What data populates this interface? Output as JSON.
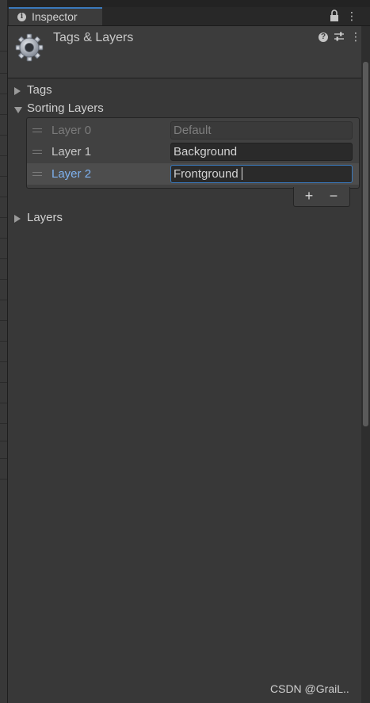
{
  "window": {
    "tab_label": "Inspector"
  },
  "header": {
    "title": "Tags & Layers"
  },
  "sections": {
    "tags": "Tags",
    "sorting_layers": "Sorting Layers",
    "layers": "Layers"
  },
  "sorting_layers": [
    {
      "label": "Layer 0",
      "value": "Default",
      "state": "disabled"
    },
    {
      "label": "Layer 1",
      "value": "Background",
      "state": "normal"
    },
    {
      "label": "Layer 2",
      "value": "Frontground",
      "state": "selected"
    }
  ],
  "list_buttons": {
    "add": "+",
    "remove": "−"
  },
  "watermark": "CSDN @GraiL..",
  "colors": {
    "accent": "#3a79bb",
    "selected_label": "#7fb2f0",
    "panel_bg": "#383838"
  }
}
